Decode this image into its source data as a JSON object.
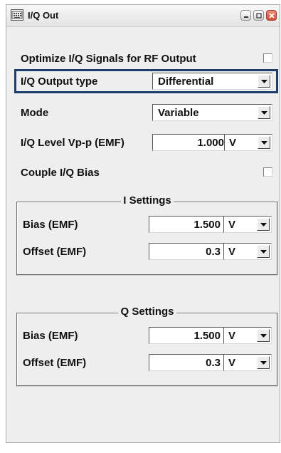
{
  "window": {
    "title": "I/Q Out"
  },
  "optimize": {
    "label": "Optimize I/Q Signals for RF Output",
    "checked": false
  },
  "output_type": {
    "label": "I/Q Output type",
    "value": "Differential"
  },
  "mode": {
    "label": "Mode",
    "value": "Variable"
  },
  "iq_level": {
    "label": "I/Q Level Vp-p (EMF)",
    "value": "1.000",
    "unit": "V"
  },
  "couple_bias": {
    "label": "Couple I/Q Bias",
    "checked": false
  },
  "i_settings": {
    "title": "I Settings",
    "bias": {
      "label": "Bias (EMF)",
      "value": "1.500",
      "unit": "V"
    },
    "offset": {
      "label": "Offset (EMF)",
      "value": "0.3",
      "unit": "V"
    }
  },
  "q_settings": {
    "title": "Q Settings",
    "bias": {
      "label": "Bias (EMF)",
      "value": "1.500",
      "unit": "V"
    },
    "offset": {
      "label": "Offset (EMF)",
      "value": "0.3",
      "unit": "V"
    }
  },
  "icons": {
    "window": "keyboard-icon",
    "minimize": "minimize-icon",
    "maximize": "maximize-icon",
    "close": "close-icon",
    "dropdown": "chevron-down-icon"
  },
  "colors": {
    "highlight": "#1d3d6c",
    "panel": "#eeeeee",
    "close_button": "#d04c33"
  }
}
